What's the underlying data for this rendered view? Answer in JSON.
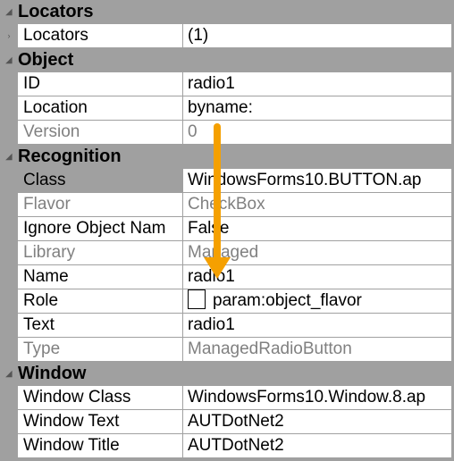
{
  "categories": [
    {
      "title": "Locators",
      "props": [
        {
          "name": "Locators",
          "value": "(1)",
          "expander": "chevron-right-icon"
        }
      ]
    },
    {
      "title": "Object",
      "props": [
        {
          "name": "ID",
          "value": "radio1"
        },
        {
          "name": "Location",
          "value": "byname:"
        },
        {
          "name": "Version",
          "value": "0",
          "readonly": true
        }
      ]
    },
    {
      "title": "Recognition",
      "props": [
        {
          "name": "Class",
          "value": "WindowsForms10.BUTTON.ap",
          "selected": true
        },
        {
          "name": "Flavor",
          "value": "CheckBox",
          "readonly": true
        },
        {
          "name": "Ignore Object Nam",
          "value": "False"
        },
        {
          "name": "Library",
          "value": "Managed",
          "readonly": true
        },
        {
          "name": "Name",
          "value": "radio1"
        },
        {
          "name": "Role",
          "value": "param:object_flavor",
          "checkbox": true
        },
        {
          "name": "Text",
          "value": "radio1"
        },
        {
          "name": "Type",
          "value": "ManagedRadioButton",
          "readonly": true
        }
      ]
    },
    {
      "title": "Window",
      "props": [
        {
          "name": "Window Class",
          "value": "WindowsForms10.Window.8.ap"
        },
        {
          "name": "Window Text",
          "value": "AUTDotNet2"
        },
        {
          "name": "Window Title",
          "value": "AUTDotNet2"
        }
      ]
    }
  ],
  "colors": {
    "arrow": "#f5a000",
    "category_bg": "#a0a0a0",
    "readonly_text": "#808080"
  }
}
